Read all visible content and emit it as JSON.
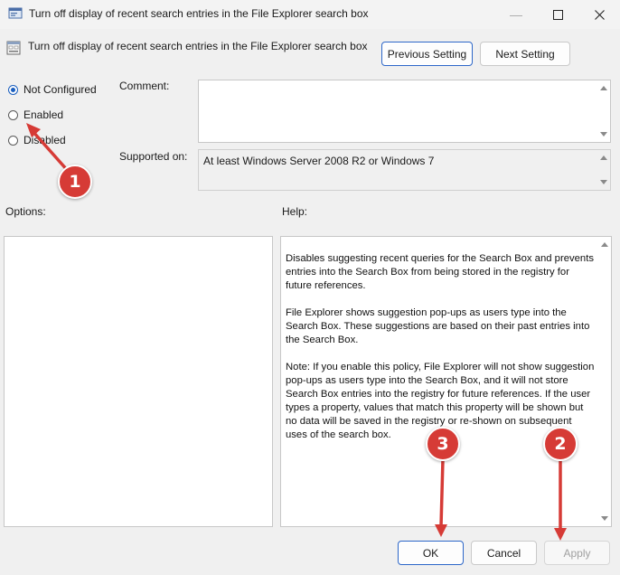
{
  "window": {
    "title": "Turn off display of recent search entries in the File Explorer search box",
    "minimize_glyph": "—",
    "maximize_glyph": "☐",
    "close_glyph": "✕"
  },
  "setting": {
    "name": "Turn off display of recent search entries in the File Explorer search box",
    "previous_label": "Previous Setting",
    "next_label": "Next Setting"
  },
  "state_options": [
    {
      "label": "Not Configured",
      "checked": true
    },
    {
      "label": "Enabled",
      "checked": false
    },
    {
      "label": "Disabled",
      "checked": false
    }
  ],
  "comment": {
    "label": "Comment:",
    "value": ""
  },
  "supported_on": {
    "label": "Supported on:",
    "value": "At least Windows Server 2008 R2 or Windows 7"
  },
  "options": {
    "label": "Options:"
  },
  "help": {
    "label": "Help:",
    "paragraphs": [
      "Disables suggesting recent queries for the Search Box and prevents entries into the Search Box from being stored in the registry for future references.",
      "File Explorer shows suggestion pop-ups as users type into the Search Box.  These suggestions are based on their past entries into the Search Box.",
      "Note: If you enable this policy, File Explorer will not show suggestion pop-ups as users type into the Search Box, and it will not store Search Box entries into the registry for future references.  If the user types a property, values that match this property will be shown but no data will be saved in the registry or re-shown on subsequent uses of the search box."
    ]
  },
  "buttons": {
    "ok": "OK",
    "cancel": "Cancel",
    "apply": "Apply"
  },
  "annotations": {
    "badge_1": "1",
    "badge_2": "2",
    "badge_3": "3",
    "color": "#d63b36"
  }
}
